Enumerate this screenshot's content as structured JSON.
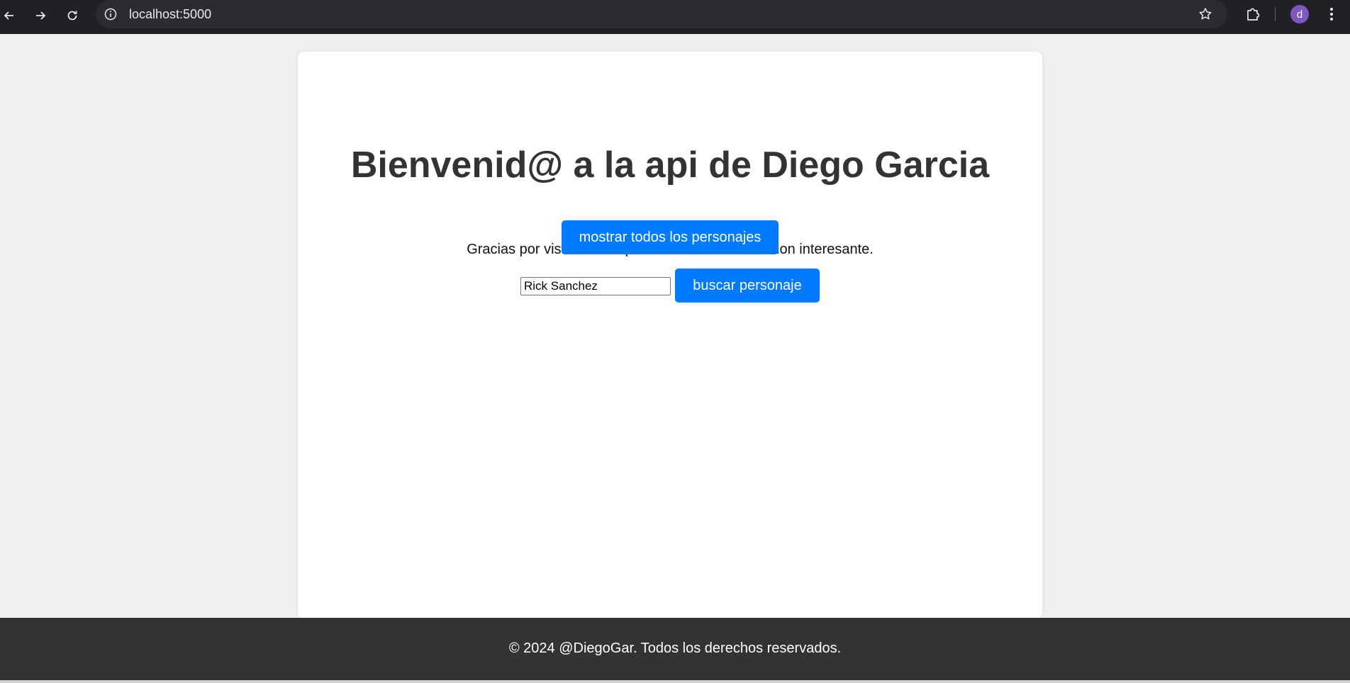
{
  "browser": {
    "url": "localhost:5000",
    "profile_initial": "d",
    "icons": {
      "back": "arrow-left-icon",
      "forward": "arrow-right-icon",
      "reload": "reload-icon",
      "site_info": "info-icon",
      "bookmark": "star-icon",
      "extensions": "puzzle-icon",
      "menu": "kebab-menu-icon"
    }
  },
  "page": {
    "title": "Bienvenid@ a la api de Diego Garcia",
    "subtitle": "Gracias por visitarnos. Aqui encontraras informacion interesante.",
    "show_all_button": "mostrar todos los personajes",
    "search": {
      "value": "Rick Sanchez",
      "button": "buscar personaje"
    }
  },
  "footer": {
    "text": "© 2024 @DiegoGar. Todos los derechos reservados."
  },
  "colors": {
    "accent": "#007bff",
    "footer_bg": "#333333",
    "page_bg": "#f0f0f0",
    "chrome_bg": "#202124",
    "avatar": "#7e57c2"
  }
}
